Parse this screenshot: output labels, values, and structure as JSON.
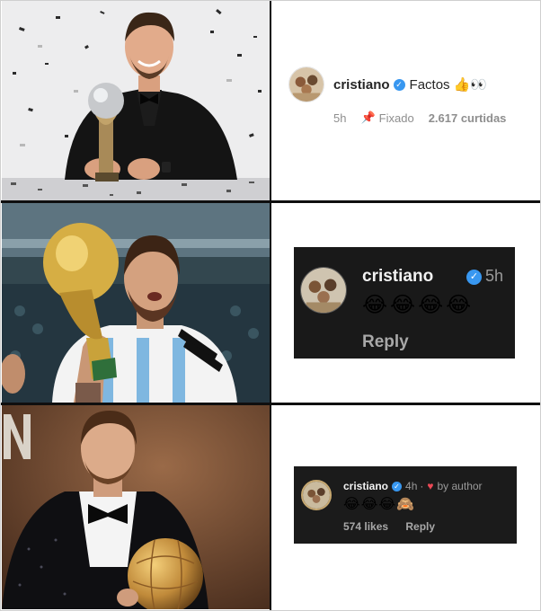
{
  "panels": [
    {
      "photo": {
        "subject": "player-with-fifa-best-trophy",
        "backdrop": "#e9e9ea"
      },
      "comment": {
        "style": "light",
        "username": "cristiano",
        "verified": true,
        "text": "Factos 👍👀",
        "time": "5h",
        "pinned_label": "Fixado",
        "likes": "2.617 curtidas"
      }
    },
    {
      "photo": {
        "subject": "player-kissing-world-cup",
        "backdrop": "#3a4f5e"
      },
      "comment": {
        "style": "dark",
        "username": "cristiano",
        "verified": true,
        "time": "5h",
        "emojis": "😂😂😂😂",
        "reply_label": "Reply"
      }
    },
    {
      "photo": {
        "subject": "player-with-ballon-dor",
        "backdrop": "#6a4632"
      },
      "comment": {
        "style": "dark",
        "username": "cristiano",
        "verified": true,
        "time": "4h",
        "separator": "·",
        "liked_by_author": "by author",
        "emojis": "😂😂😂🙈",
        "likes": "574 likes",
        "reply_label": "Reply"
      }
    }
  ],
  "colors": {
    "verified_blue": "#3897f0",
    "heart_red": "#ed4956",
    "dark_card": "#191919",
    "grid_lines": "#0f0f0f"
  }
}
